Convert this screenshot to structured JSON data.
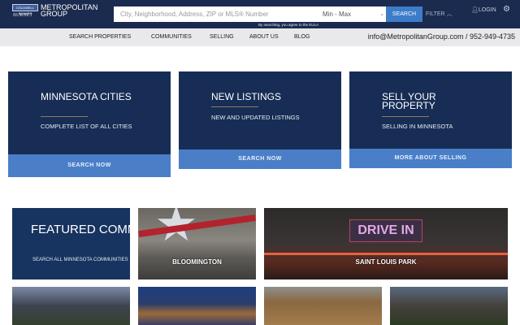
{
  "header": {
    "logo_badge": "COLDWELL BANKER",
    "logo_sub": "BURNET",
    "logo_name_1": "METROPOLITAN",
    "logo_name_2": "GROUP",
    "search_placeholder": "City, Neighborhood, Address, ZIP or MLS® Number",
    "price_value": "Min - Max",
    "search_label": "SEARCH",
    "filter_label": "FILTER",
    "login_label": "LOGIN",
    "eula_text": "By searching, you agree to the EULA"
  },
  "nav": {
    "items": [
      "SEARCH PROPERTIES",
      "COMMUNITIES",
      "SELLING",
      "ABOUT US",
      "BLOG"
    ],
    "contact": "info@MetropolitanGroup.com / 952-949-4735"
  },
  "cards": [
    {
      "title": "MINNESOTA CITIES",
      "desc": "COMPLETE LIST OF ALL CITIES",
      "button": "SEARCH NOW"
    },
    {
      "title": "NEW LISTINGS",
      "desc": "NEW AND UPDATED LISTINGS",
      "button": "SEARCH NOW"
    },
    {
      "title": "SELL YOUR PROPERTY",
      "desc": "SELLING IN MINNESOTA",
      "button": "MORE ABOUT SELLING"
    }
  ],
  "featured": {
    "title": "FEATURED COMMUNITIES",
    "link": "SEARCH ALL MINNESOTA COMMUNITIES",
    "communities": [
      "BLOOMINGTON",
      "SAINT LOUIS PARK"
    ],
    "sign_text": "DRIVE IN"
  }
}
